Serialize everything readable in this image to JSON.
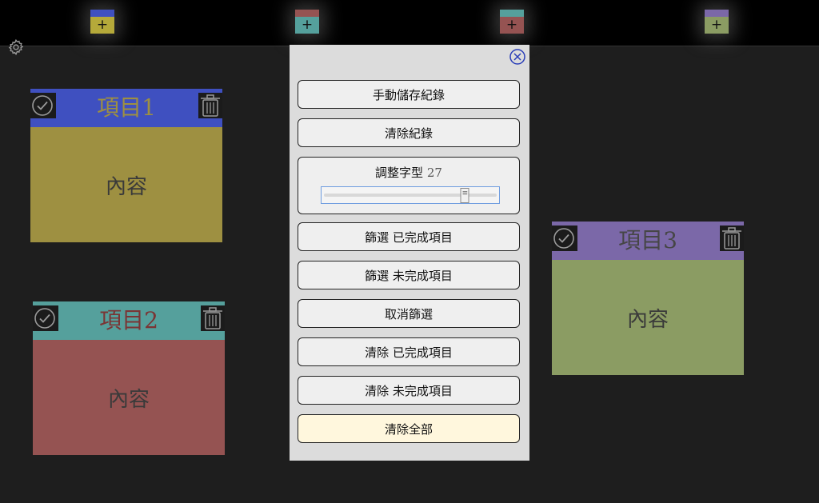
{
  "colors": {
    "note1": {
      "head": "#3f50c0",
      "body": "#9e9041",
      "title": "#9e9041"
    },
    "note2": {
      "head": "#55a09c",
      "body": "#955352",
      "title": "#7a3535"
    },
    "note3": {
      "head": "#7b68a8",
      "body": "#8b9c63",
      "title": "#464646"
    },
    "panel_bg": "#dcdcdc",
    "clear_all_bg": "#fff7dd"
  },
  "toolbar": {
    "add_buttons": [
      {
        "label": "+",
        "top_color": "#3f50c0",
        "bottom_color": "#b5a93a"
      },
      {
        "label": "+",
        "top_color": "#955352",
        "bottom_color": "#55a09c"
      },
      {
        "label": "+",
        "top_color": "#55a09c",
        "bottom_color": "#955352"
      },
      {
        "label": "+",
        "top_color": "#7b68a8",
        "bottom_color": "#8b9c63"
      }
    ],
    "settings_icon": "gear-icon"
  },
  "notes": [
    {
      "title": "項目1",
      "content": "內容"
    },
    {
      "title": "項目2",
      "content": "內容"
    },
    {
      "title": "項目3",
      "content": "內容"
    }
  ],
  "settings_panel": {
    "close_icon": "close-circle-icon",
    "manual_save": "手動儲存紀錄",
    "clear_log": "清除紀錄",
    "font_adjust_label": "調整字型",
    "font_size": "27",
    "font_slider": {
      "min": 10,
      "max": 30,
      "value": 27
    },
    "filter_done": "篩選 已完成項目",
    "filter_undone": "篩選 未完成項目",
    "cancel_filter": "取消篩選",
    "clear_done": "清除 已完成項目",
    "clear_undone": "清除 未完成項目",
    "clear_all": "清除全部"
  }
}
